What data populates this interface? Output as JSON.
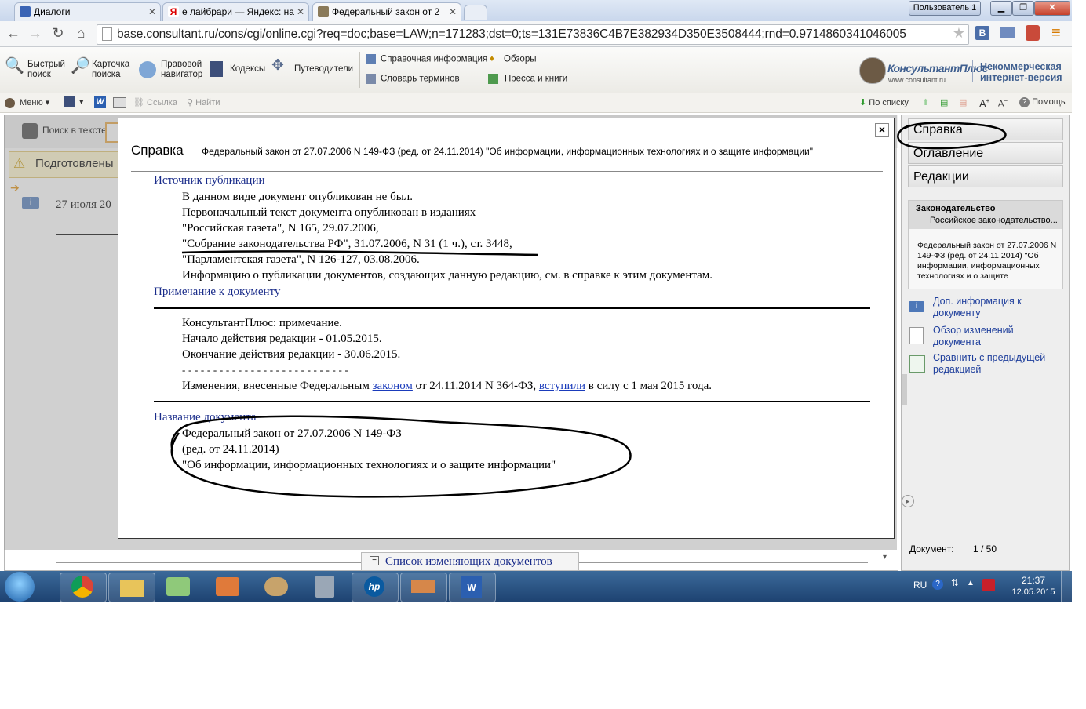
{
  "browser": {
    "tabs": [
      {
        "title": "Диалоги"
      },
      {
        "title": "е лайбрари — Яндекс: на"
      },
      {
        "title": "Федеральный закон от 2"
      }
    ],
    "user_label": "Пользователь 1",
    "url": "base.consultant.ru/cons/cgi/online.cgi?req=doc;base=LAW;n=171283;dst=0;ts=131E73836C4B7E382934D350E3508444;rnd=0.9714860341046005"
  },
  "toolbar": {
    "quick_search": "Быстрый поиск",
    "card_search": "Карточка поиска",
    "legal_navigator": "Правовой навигатор",
    "codexes": "Кодексы",
    "guides": "Путеводители",
    "reference_info": "Справочная информация",
    "reviews": "Обзоры",
    "glossary": "Словарь терминов",
    "press": "Пресса и книги",
    "brand": "КонсультантПлюс",
    "brand_url": "www.consultant.ru",
    "edition_line1": "Некоммерческая",
    "edition_line2": "интернет-версия"
  },
  "toolbar2": {
    "menu": "Меню",
    "link": "Ссылка",
    "find": "Найти",
    "by_list": "По списку",
    "help": "Помощь"
  },
  "doc": {
    "search_in_text": "Поиск в тексте",
    "prepared_banner": "Подготовлены",
    "date_fragment": "27 июля 20",
    "changes_list": "Список изменяющих документов"
  },
  "right": {
    "tab_reference": "Справка",
    "tab_toc": "Оглавление",
    "tab_editions": "Редакции",
    "legislation_title": "Законодательство",
    "legislation_sub": "Российское законодательство...",
    "doc_name": "Федеральный закон от 27.07.2006 N 149-ФЗ (ред. от 24.11.2014) \"Об информации, информационных технологиях и о защите",
    "link_more_info": "Доп. информация к документу",
    "link_changes_review": "Обзор изменений документа",
    "link_compare": "Сравнить с предыдущей редакцией",
    "doc_counter_label": "Документ:",
    "doc_counter": "1 / 50"
  },
  "modal": {
    "title": "Справка",
    "subtitle": "Федеральный закон от 27.07.2006 N 149-ФЗ (ред. от 24.11.2014) \"Об информации, информационных технологиях и о защите информации\"",
    "close": "×",
    "sec_source": "Источник публикации",
    "src_1": "В данном виде документ опубликован не был.",
    "src_2": "Первоначальный текст документа опубликован в изданиях",
    "src_3": "\"Российская газета\", N 165, 29.07.2006,",
    "src_4": "\"Собрание законодательства РФ\", 31.07.2006, N 31 (1 ч.), ст. 3448,",
    "src_5": "\"Парламентская газета\", N 126-127, 03.08.2006.",
    "src_6": "Информацию о публикации документов, создающих данную редакцию, см. в справке к этим документам.",
    "sec_note": "Примечание к документу",
    "note_1": "КонсультантПлюс: примечание.",
    "note_2": "Начало действия редакции - 01.05.2015.",
    "note_3": "Окончание действия редакции - 30.06.2015.",
    "note_dashes": "- - - - - - - - - - - - - - - - - - - - - - - - - - -",
    "note_5a": "Изменения, внесенные Федеральным ",
    "note_5_link1": "законом",
    "note_5b": " от 24.11.2014 N 364-ФЗ, ",
    "note_5_link2": "вступили",
    "note_5c": " в силу с 1 мая 2015 года.",
    "sec_name": "Название документа",
    "name_1": "Федеральный закон от 27.07.2006 N 149-ФЗ",
    "name_2": "(ред. от 24.11.2014)",
    "name_3": "\"Об информации, информационных технологиях и о защите информации\""
  },
  "taskbar": {
    "lang": "RU",
    "time": "21:37",
    "date": "12.05.2015"
  }
}
